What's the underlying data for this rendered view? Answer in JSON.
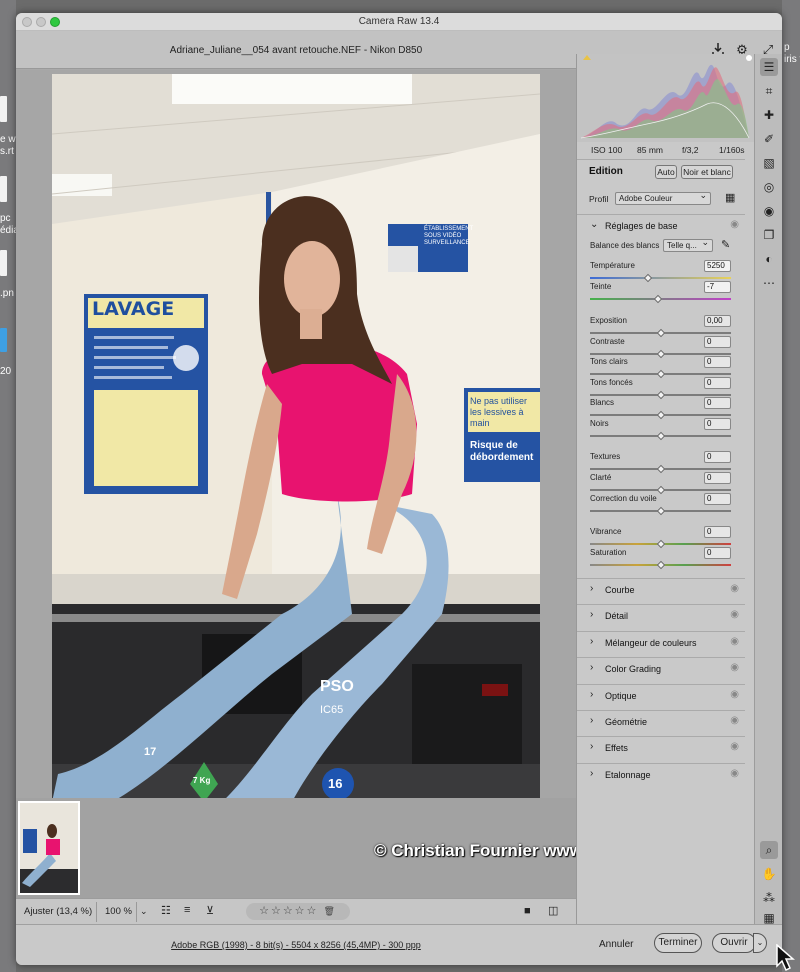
{
  "window": {
    "app_title": "Camera Raw 13.4",
    "file_title": "Adriane_Juliane__054 avant retouche.NEF  -  Nikon D850"
  },
  "desktop": {
    "left_fragments": [
      "e w",
      "s.rt",
      "pc",
      "édia",
      ".pn",
      "20"
    ],
    "right_fragments": [
      "p",
      "iris f"
    ]
  },
  "camera_info": {
    "iso": "ISO 100",
    "focal": "85 mm",
    "aperture": "f/3,2",
    "shutter": "1/160s"
  },
  "edit": {
    "title": "Edition",
    "auto_label": "Auto",
    "bw_label": "Noir et blanc",
    "profile_label": "Profil",
    "profile_value": "Adobe Couleur"
  },
  "basic": {
    "title": "Réglages de base",
    "wb_label": "Balance des blancs",
    "wb_value": "Telle q...",
    "sliders": [
      {
        "label": "Température",
        "value": "5250",
        "level": 0.41
      },
      {
        "label": "Teinte",
        "value": "-7",
        "level": 0.48
      },
      {
        "label": "Exposition",
        "value": "0,00",
        "level": 0.5
      },
      {
        "label": "Contraste",
        "value": "0",
        "level": 0.5
      },
      {
        "label": "Tons clairs",
        "value": "0",
        "level": 0.5
      },
      {
        "label": "Tons foncés",
        "value": "0",
        "level": 0.5
      },
      {
        "label": "Blancs",
        "value": "0",
        "level": 0.5
      },
      {
        "label": "Noirs",
        "value": "0",
        "level": 0.5
      },
      {
        "label": "Textures",
        "value": "0",
        "level": 0.5
      },
      {
        "label": "Clarté",
        "value": "0",
        "level": 0.5
      },
      {
        "label": "Correction du voile",
        "value": "0",
        "level": 0.5
      },
      {
        "label": "Vibrance",
        "value": "0",
        "level": 0.5
      },
      {
        "label": "Saturation",
        "value": "0",
        "level": 0.5
      }
    ]
  },
  "sections": [
    "Courbe",
    "Détail",
    "Mélangeur de couleurs",
    "Color Grading",
    "Optique",
    "Géométrie",
    "Effets",
    "Etalonnage"
  ],
  "bottom": {
    "fit_label": "Ajuster (13,4 %)",
    "zoom_value": "100 %",
    "stars": "☆☆☆☆☆"
  },
  "footer": {
    "info_link": "Adobe RGB (1998) - 8 bit(s) - 5504 x 8256 (45,4MP) - 300 ppp",
    "cancel": "Annuler",
    "done": "Terminer",
    "open": "Ouvrir"
  },
  "watermark": "© Christian Fournier www.prisedevue.com",
  "photo_signs": {
    "lavage": "LAVAGE",
    "sign_right_1": "Ne pas utiliser",
    "sign_right_2": "les lessives à main",
    "sign_right_3": "Risque de",
    "sign_right_4": "débordement",
    "sign_top_1": "ÉTABLISSEMENT",
    "sign_top_2": "SOUS VIDÉO",
    "sign_top_3": "SURVEILLANCE",
    "machine_label": "PSO",
    "machine_num": "IC65",
    "badge_17": "17",
    "badge_16": "16",
    "badge_7kg": "7 Kg"
  },
  "colors": {
    "accent_magenta": "#e8136f",
    "sign_blue": "#1f4f9e",
    "panel_bg": "#c9c9c9"
  }
}
